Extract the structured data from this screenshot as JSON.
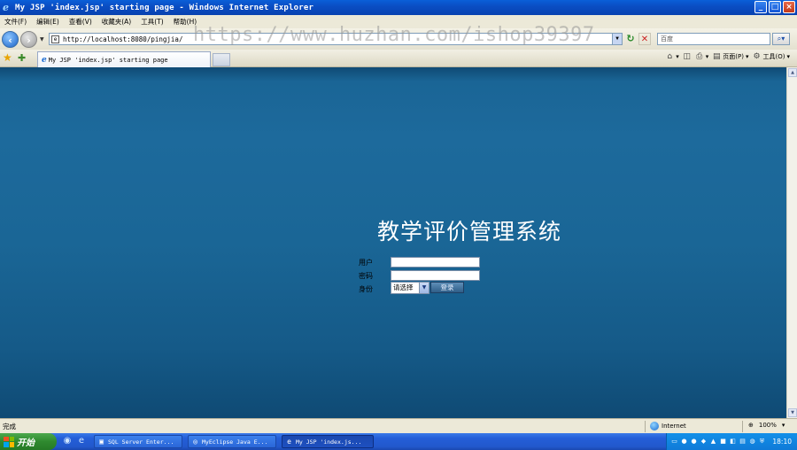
{
  "window": {
    "title": "My JSP 'index.jsp' starting page - Windows Internet Explorer",
    "buttons": [
      "minimize",
      "maximize",
      "close"
    ]
  },
  "menu": [
    "文件(F)",
    "编辑(E)",
    "查看(V)",
    "收藏夹(A)",
    "工具(T)",
    "帮助(H)"
  ],
  "address": {
    "url": "http://localhost:8080/pingjia/",
    "search_placeholder": "百度"
  },
  "watermark": "https://www.huzhan.com/ishop39397",
  "tab": {
    "title": "My JSP 'index.jsp' starting page"
  },
  "command_bar": {
    "page_label": "页面(P)",
    "tools_label": "工具(O)"
  },
  "login": {
    "system_title": "教学评价管理系统",
    "user_label": "用户",
    "password_label": "密码",
    "role_label": "身份",
    "role_selected": "请选择",
    "login_button": "登录"
  },
  "status": {
    "text": "完成",
    "zone": "Internet",
    "zoom": "100%"
  },
  "taskbar": {
    "start_label": "开始",
    "tasks": [
      "SQL Server Enter...",
      "MyEclipse Java E...",
      "My JSP 'index.js..."
    ],
    "clock": "18:10"
  },
  "icons": {
    "ie_logo": "ie-icon",
    "back": "back-arrow-icon",
    "forward": "forward-arrow-icon",
    "refresh": "refresh-icon",
    "stop": "stop-icon",
    "search": "search-icon",
    "favorites": "star-icon",
    "add_favorites": "add-favorite-icon",
    "home": "home-icon",
    "feeds": "rss-icon",
    "print": "printer-icon"
  },
  "colors": {
    "titlebar": "#0a4ec4",
    "content_bg": "#1a6596",
    "login_button": "#2f5e88"
  }
}
